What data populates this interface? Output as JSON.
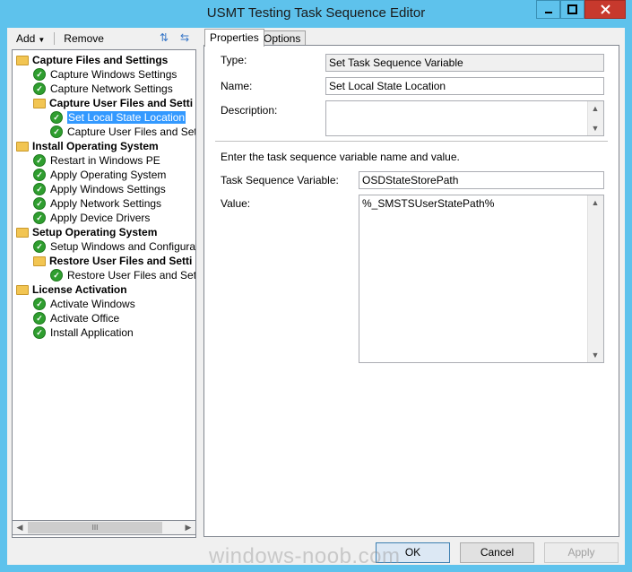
{
  "window": {
    "title": "USMT Testing Task Sequence Editor",
    "minimize_icon": "minimize-icon",
    "maximize_icon": "maximize-icon",
    "close_icon": "close-icon"
  },
  "toolbar": {
    "add_label": "Add",
    "remove_label": "Remove",
    "icons": [
      "move-up-icon",
      "move-down-icon"
    ]
  },
  "tree": {
    "nodes": [
      {
        "label": "Capture Files and Settings",
        "type": "group"
      },
      {
        "label": "Capture Windows Settings",
        "type": "step"
      },
      {
        "label": "Capture Network Settings",
        "type": "step"
      },
      {
        "label": "Capture User Files and Setti",
        "type": "group"
      },
      {
        "label": "Set Local State Location",
        "type": "step",
        "selected": true
      },
      {
        "label": "Capture User Files and Setting",
        "type": "step"
      },
      {
        "label": "Install Operating System",
        "type": "group"
      },
      {
        "label": "Restart in Windows PE",
        "type": "step"
      },
      {
        "label": "Apply Operating System",
        "type": "step"
      },
      {
        "label": "Apply Windows Settings",
        "type": "step"
      },
      {
        "label": "Apply Network Settings",
        "type": "step"
      },
      {
        "label": "Apply Device Drivers",
        "type": "step"
      },
      {
        "label": "Setup Operating System",
        "type": "group"
      },
      {
        "label": "Setup Windows and Configuration",
        "type": "step"
      },
      {
        "label": "Restore User Files and Setti",
        "type": "group"
      },
      {
        "label": "Restore User Files and Setting",
        "type": "step"
      },
      {
        "label": "License Activation",
        "type": "group"
      },
      {
        "label": "Activate Windows",
        "type": "step"
      },
      {
        "label": "Activate Office",
        "type": "step"
      },
      {
        "label": "Install Application",
        "type": "step"
      }
    ],
    "scroll_grip": "III"
  },
  "tabs": {
    "properties": "Properties",
    "options": "Options"
  },
  "properties": {
    "type_label": "Type:",
    "type_value": "Set Task Sequence Variable",
    "name_label": "Name:",
    "name_value": "Set Local State Location",
    "description_label": "Description:",
    "description_value": "",
    "instructions": "Enter the task sequence variable name and value.",
    "variable_label": "Task Sequence Variable:",
    "variable_value": "OSDStateStorePath",
    "value_label": "Value:",
    "value_value": "%_SMSTSUserStatePath%"
  },
  "buttons": {
    "ok": "OK",
    "cancel": "Cancel",
    "apply": "Apply"
  },
  "watermark": "windows-noob.com"
}
